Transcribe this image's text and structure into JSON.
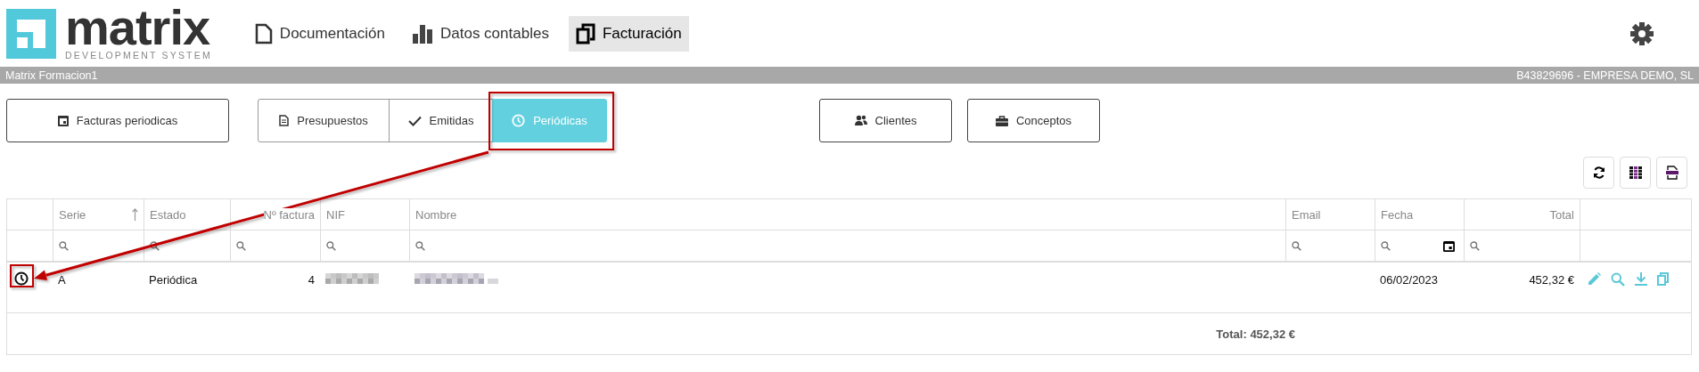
{
  "logo": {
    "name": "matrix",
    "tagline": "DEVELOPMENT SYSTEM"
  },
  "nav": [
    {
      "label": "Documentación",
      "selected": false
    },
    {
      "label": "Datos contables",
      "selected": false
    },
    {
      "label": "Facturación",
      "selected": true
    }
  ],
  "company_bar": {
    "user": "Matrix Formacion1",
    "company": "B43829696 - EMPRESA DEMO, SL"
  },
  "main_button": {
    "label": "Facturas periodicas"
  },
  "segments": [
    {
      "label": "Presupuestos",
      "selected": false
    },
    {
      "label": "Emitidas",
      "selected": false
    },
    {
      "label": "Periódicas",
      "selected": true
    }
  ],
  "side_buttons": [
    {
      "label": "Clientes"
    },
    {
      "label": "Conceptos"
    }
  ],
  "table": {
    "columns": [
      {
        "label": "Serie",
        "sorted": true
      },
      {
        "label": "Estado",
        "sorted": false
      },
      {
        "label": "Nº factura",
        "sorted": false
      },
      {
        "label": "NIF",
        "sorted": false
      },
      {
        "label": "Nombre",
        "sorted": false
      },
      {
        "label": "Email",
        "sorted": false
      },
      {
        "label": "Fecha",
        "sorted": false
      },
      {
        "label": "Total",
        "sorted": false
      }
    ],
    "rows": [
      {
        "serie": "A",
        "estado": "Periódica",
        "numero": "4",
        "fecha": "06/02/2023",
        "total": "452,32 €"
      }
    ],
    "footer_total": "Total: 452,32 €"
  }
}
